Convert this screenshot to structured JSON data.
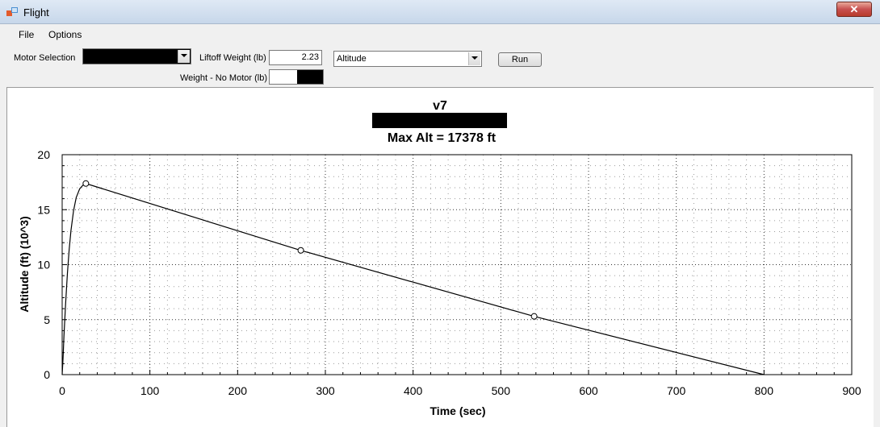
{
  "window": {
    "title": "Flight",
    "close_glyph": "✕"
  },
  "menu": {
    "file": "File",
    "options": "Options"
  },
  "controls": {
    "motor_label": "Motor Selection",
    "liftoff_label": "Liftoff Weight (lb)",
    "liftoff_value": "2.23",
    "weight_no_motor_label": "Weight - No Motor (lb)",
    "plot_select_value": "Altitude",
    "run_label": "Run"
  },
  "chart_data": {
    "type": "line",
    "title": "v7",
    "subtitle": "Max Alt = 17378 ft",
    "xlabel": "Time (sec)",
    "ylabel": "Altitude (ft) (10^3)",
    "xlim": [
      0,
      900
    ],
    "ylim": [
      0,
      20
    ],
    "xticks": [
      0,
      100,
      200,
      300,
      400,
      500,
      600,
      700,
      800,
      900
    ],
    "yticks": [
      0,
      5,
      10,
      15,
      20
    ],
    "grid": true,
    "series": [
      {
        "color": "#000000",
        "points": [
          [
            0,
            0
          ],
          [
            1,
            1.5
          ],
          [
            2,
            3.5
          ],
          [
            4,
            6.5
          ],
          [
            6,
            9.2
          ],
          [
            8,
            11.4
          ],
          [
            10,
            13.1
          ],
          [
            13,
            14.9
          ],
          [
            16,
            16.1
          ],
          [
            20,
            16.9
          ],
          [
            24,
            17.25
          ],
          [
            27,
            17.378
          ],
          [
            272,
            11.3
          ],
          [
            538,
            5.3
          ],
          [
            800,
            0
          ]
        ],
        "markers": [
          [
            27,
            17.378
          ],
          [
            272,
            11.3
          ],
          [
            538,
            5.3
          ]
        ]
      }
    ]
  }
}
